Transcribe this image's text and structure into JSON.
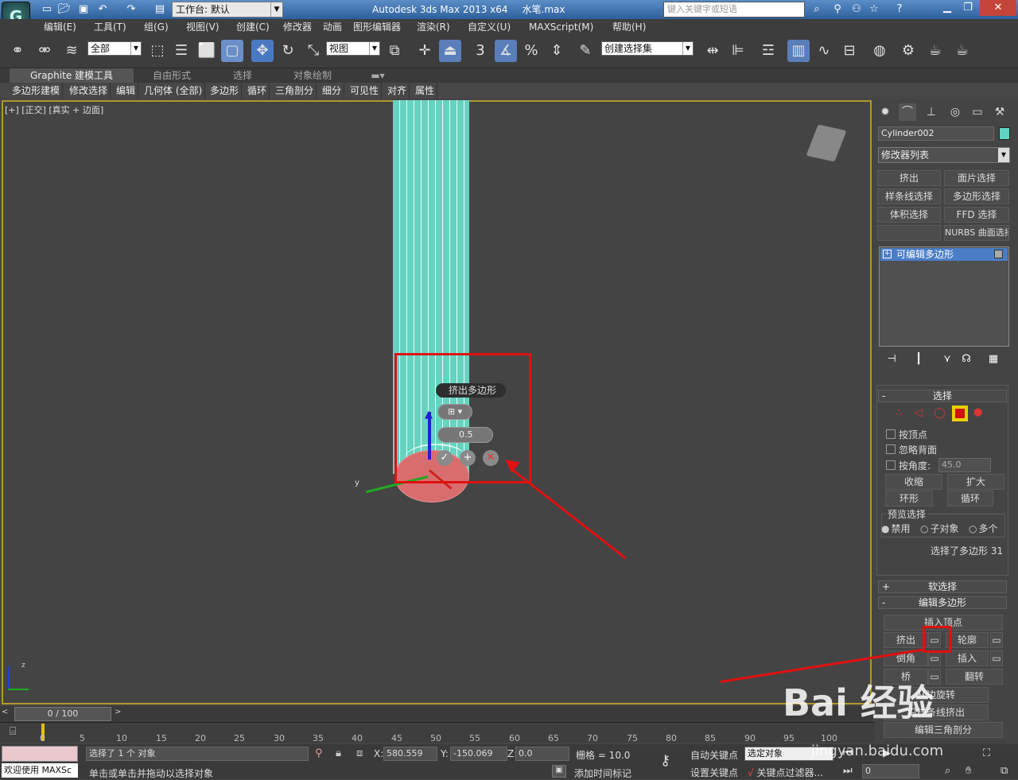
{
  "titlebar": {
    "logo": "G",
    "workspace": "工作台: 默认",
    "app_name": "Autodesk 3ds Max  2013 x64",
    "file_name": "水笔.max",
    "search_placeholder": "键入关键字或短语"
  },
  "menu": [
    "编辑(E)",
    "工具(T)",
    "组(G)",
    "视图(V)",
    "创建(C)",
    "修改器",
    "动画",
    "图形编辑器",
    "渲染(R)",
    "自定义(U)",
    "MAXScript(M)",
    "帮助(H)"
  ],
  "toolbar": {
    "selection_filter": "全部",
    "ref_coord": "视图",
    "named_selection": "创建选择集",
    "snap_num": "3",
    "percent_symbol": "%"
  },
  "ribbon": {
    "tabs": [
      "Graphite 建模工具",
      "自由形式",
      "选择",
      "对象绘制"
    ],
    "sub": [
      "多边形建模",
      "修改选择",
      "编辑",
      "几何体 (全部)",
      "多边形",
      "循环",
      "三角剖分",
      "细分",
      "可见性",
      "对齐",
      "属性"
    ]
  },
  "viewport": {
    "label": "[+] [正交] [真实 + 边面]",
    "caddy_title": "挤出多边形",
    "caddy_value": "0.5",
    "axis_y": "y",
    "axis_z": "z"
  },
  "panel": {
    "object_name": "Cylinder002",
    "object_color": "#5fd3c0",
    "modifier_list": "修改器列表",
    "mod_buttons": [
      "挤出",
      "面片选择",
      "样条线选择",
      "多边形选择",
      "体积选择",
      "FFD 选择",
      "",
      "NURBS 曲面选择"
    ],
    "stack_item": "可编辑多边形",
    "selection": {
      "title": "选择",
      "by_vertex": "按顶点",
      "ignore_backface": "忽略背面",
      "by_angle": "按角度:",
      "angle_value": "45.0",
      "shrink": "收缩",
      "grow": "扩大",
      "ring": "环形",
      "loop": "循环",
      "preview_title": "预览选择",
      "preview_options": [
        "禁用",
        "子对象",
        "多个"
      ],
      "status": "选择了多边形 31"
    },
    "soft_selection": "软选择",
    "edit_poly": {
      "title": "编辑多边形",
      "insert_vertex": "插入顶点",
      "extrude": "挤出",
      "outline": "轮廓",
      "bevel": "倒角",
      "inset": "插入",
      "bridge": "桥",
      "flip": "翻转",
      "hinge": "从边旋转",
      "extrude_along": "沿样条线挤出",
      "edit_tri": "编辑三角剖分"
    }
  },
  "timeline": {
    "frame": "0 / 100",
    "ticks": [
      "0",
      "5",
      "10",
      "15",
      "20",
      "25",
      "30",
      "35",
      "40",
      "45",
      "50",
      "55",
      "60",
      "65",
      "70",
      "75",
      "80",
      "85",
      "90",
      "95",
      "100"
    ]
  },
  "status": {
    "welcome": "欢迎使用 MAXSc",
    "selected": "选择了 1 个 对象",
    "prompt": "单击或单击并拖动以选择对象",
    "x_label": "X:",
    "x_value": "580.559",
    "y_label": "Y:",
    "y_value": "-150.069",
    "z_label": "Z:",
    "z_value": "0.0",
    "grid": "栅格 = 10.0",
    "add_time_tag": "添加时间标记",
    "auto_key": "自动关键点",
    "set_key": "设置关键点",
    "selected_object": "选定对象",
    "key_filter": "关键点过滤器...",
    "frame_field": "0"
  },
  "watermark": {
    "brand": "Bai 经验",
    "url": "jingyan.baidu.com"
  }
}
